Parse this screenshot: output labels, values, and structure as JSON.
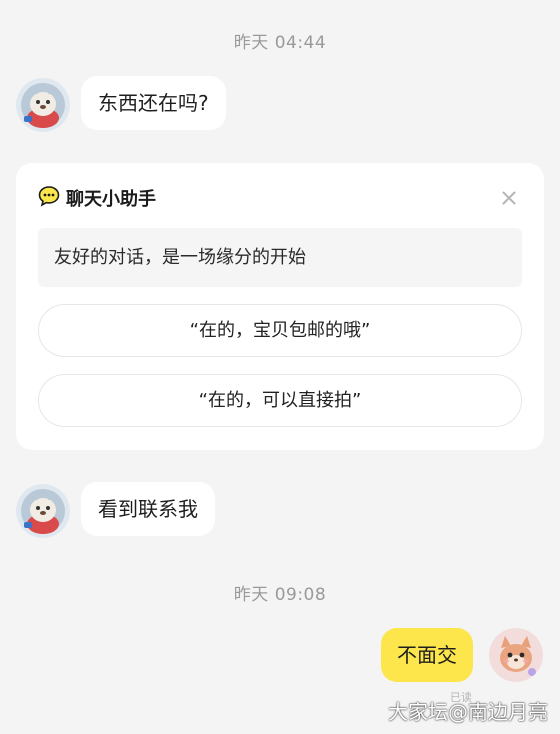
{
  "messages": {
    "timestamp_1": "昨天 04:44",
    "incoming_1": "东西还在吗?",
    "incoming_2": "看到联系我",
    "timestamp_2": "昨天 09:08",
    "outgoing_1": "不面交",
    "read_status": "已读"
  },
  "assistant_card": {
    "title": "聊天小助手",
    "tip": "友好的对话，是一场缘分的开始",
    "suggestions": [
      "“在的，宝贝包邮的哦”",
      "“在的，可以直接拍”"
    ],
    "close_icon": "close-icon",
    "chat_icon": "chat-bubble-icon"
  },
  "watermark": "大家坛@南边月亮",
  "colors": {
    "background": "#f4f4f4",
    "outgoing_bubble": "#fde64b",
    "incoming_bubble": "#ffffff",
    "timestamp": "#9a9a9a"
  }
}
